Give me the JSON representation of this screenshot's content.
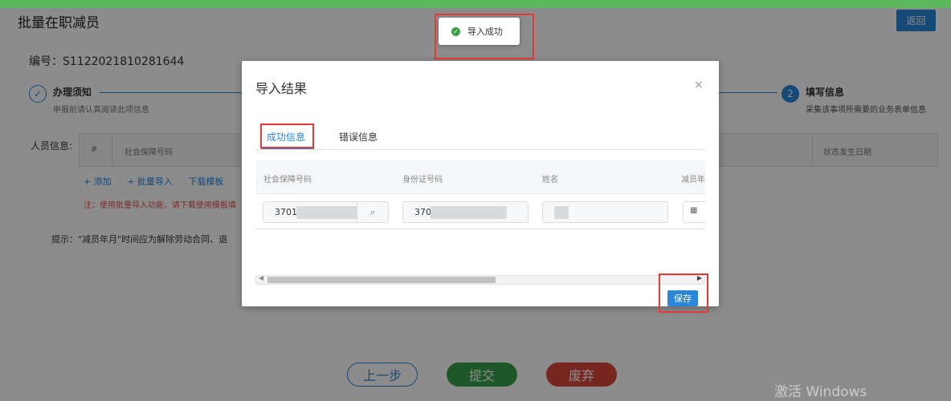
{
  "page": {
    "title": "批量在职减员",
    "back_label": "返回",
    "serial_label": "编号：S1122021810281644",
    "steps": [
      {
        "number": "✓",
        "title": "办理须知",
        "desc": "申报前请认真阅读此项信息"
      },
      {
        "number": "2",
        "title": "填写信息",
        "desc": "采集该事项所需要的业务表单信息"
      }
    ],
    "person_label": "人员信息:",
    "table_headers": {
      "hash": "#",
      "ssn": "社会保障号码",
      "date": "状态发生日期"
    },
    "actions": [
      "+ 添加",
      "+ 批量导入",
      "下载模板"
    ],
    "note": "注：使用批量导入功能，请下载使用模板填",
    "tip": "提示：\"减员年月\"时间应为解除劳动合同、退",
    "bottom_buttons": {
      "prev": "上一步",
      "submit": "提交",
      "abandon": "废弃"
    }
  },
  "toast": {
    "icon": "check-circle-icon",
    "text": "导入成功"
  },
  "modal": {
    "title": "导入结果",
    "close": "×",
    "tabs": [
      {
        "label": "成功信息",
        "active": true
      },
      {
        "label": "错误信息",
        "active": false
      }
    ],
    "columns": [
      "社会保障号码",
      "身份证号码",
      "姓名",
      "减员年"
    ],
    "row": {
      "ssn": "3701",
      "id_number": "370",
      "name": "",
      "date_icon": "calendar-icon"
    },
    "save_label": "保存"
  },
  "watermark": "激活 Windows",
  "colors": {
    "primary": "#2b86d9",
    "success": "#3aa04a",
    "danger": "#d9483b",
    "highlight": "#e33a3a"
  }
}
